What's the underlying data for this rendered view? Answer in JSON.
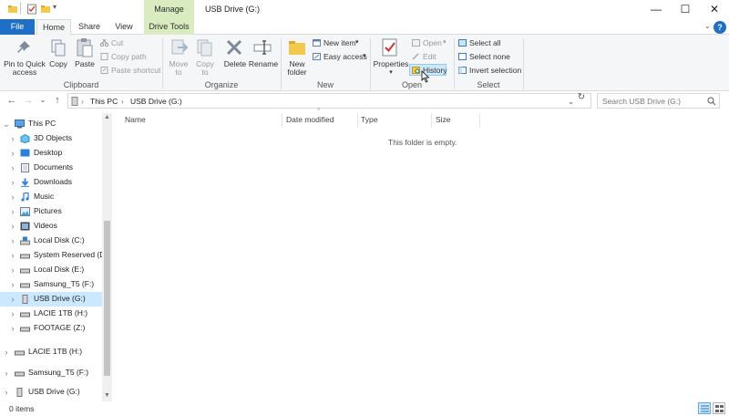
{
  "window": {
    "title": "USB Drive (G:)",
    "context_tab_group": "Manage",
    "controls": {
      "minimize": "—",
      "maximize": "☐",
      "close": "✕"
    }
  },
  "tabs": [
    {
      "label": "File",
      "active": false
    },
    {
      "label": "Home",
      "active": true
    },
    {
      "label": "Share",
      "active": false
    },
    {
      "label": "View",
      "active": false
    },
    {
      "label": "Drive Tools",
      "active": false,
      "contextual": true
    }
  ],
  "help": "?",
  "ribbon": {
    "clipboard": {
      "label": "Clipboard",
      "pin_to_quick_access": [
        "Pin to Quick",
        "access"
      ],
      "copy": "Copy",
      "paste": "Paste",
      "cut": "Cut",
      "copy_path": "Copy path",
      "paste_shortcut": "Paste shortcut"
    },
    "organize": {
      "label": "Organize",
      "move_to": [
        "Move",
        "to"
      ],
      "copy_to": [
        "Copy",
        "to"
      ],
      "delete": "Delete",
      "rename": "Rename"
    },
    "new": {
      "label": "New",
      "new_folder": [
        "New",
        "folder"
      ],
      "new_item": "New item",
      "easy_access": "Easy access"
    },
    "open": {
      "label": "Open",
      "properties": "Properties",
      "open": "Open",
      "edit": "Edit",
      "history": "History"
    },
    "select": {
      "label": "Select",
      "select_all": "Select all",
      "select_none": "Select none",
      "invert_selection": "Invert selection"
    }
  },
  "address": {
    "crumbs": [
      "This PC",
      "USB Drive (G:)"
    ],
    "search_placeholder": "Search USB Drive (G:)"
  },
  "nav_tree": [
    {
      "label": "This PC",
      "icon": "pc-icon",
      "level": 0,
      "expanded": true
    },
    {
      "label": "3D Objects",
      "icon": "3d-objects-icon",
      "level": 1
    },
    {
      "label": "Desktop",
      "icon": "desktop-icon",
      "level": 1
    },
    {
      "label": "Documents",
      "icon": "documents-icon",
      "level": 1
    },
    {
      "label": "Downloads",
      "icon": "downloads-icon",
      "level": 1
    },
    {
      "label": "Music",
      "icon": "music-icon",
      "level": 1
    },
    {
      "label": "Pictures",
      "icon": "pictures-icon",
      "level": 1
    },
    {
      "label": "Videos",
      "icon": "videos-icon",
      "level": 1
    },
    {
      "label": "Local Disk (C:)",
      "icon": "windows-drive-icon",
      "level": 1
    },
    {
      "label": "System Reserved (D:)",
      "icon": "drive-icon",
      "level": 1
    },
    {
      "label": "Local Disk (E:)",
      "icon": "drive-icon",
      "level": 1
    },
    {
      "label": "Samsung_T5 (F:)",
      "icon": "drive-icon",
      "level": 1
    },
    {
      "label": "USB Drive (G:)",
      "icon": "usb-drive-icon",
      "level": 1,
      "selected": true
    },
    {
      "label": "LACIE 1TB (H:)",
      "icon": "drive-icon",
      "level": 1
    },
    {
      "label": "FOOTAGE (Z:)",
      "icon": "drive-icon",
      "level": 1
    },
    {
      "label": "LACIE 1TB (H:)",
      "icon": "drive-icon",
      "level": 0
    },
    {
      "label": "Samsung_T5 (F:)",
      "icon": "drive-icon",
      "level": 0
    },
    {
      "label": "USB Drive (G:)",
      "icon": "usb-drive-icon",
      "level": 0
    }
  ],
  "columns": [
    "Name",
    "Date modified",
    "Type",
    "Size"
  ],
  "empty_message": "This folder is empty.",
  "status": {
    "items": "0 items"
  },
  "colors": {
    "accent": "#1f6fc4",
    "manage_band": "#d8ecbf",
    "selection": "#cce8ff"
  }
}
